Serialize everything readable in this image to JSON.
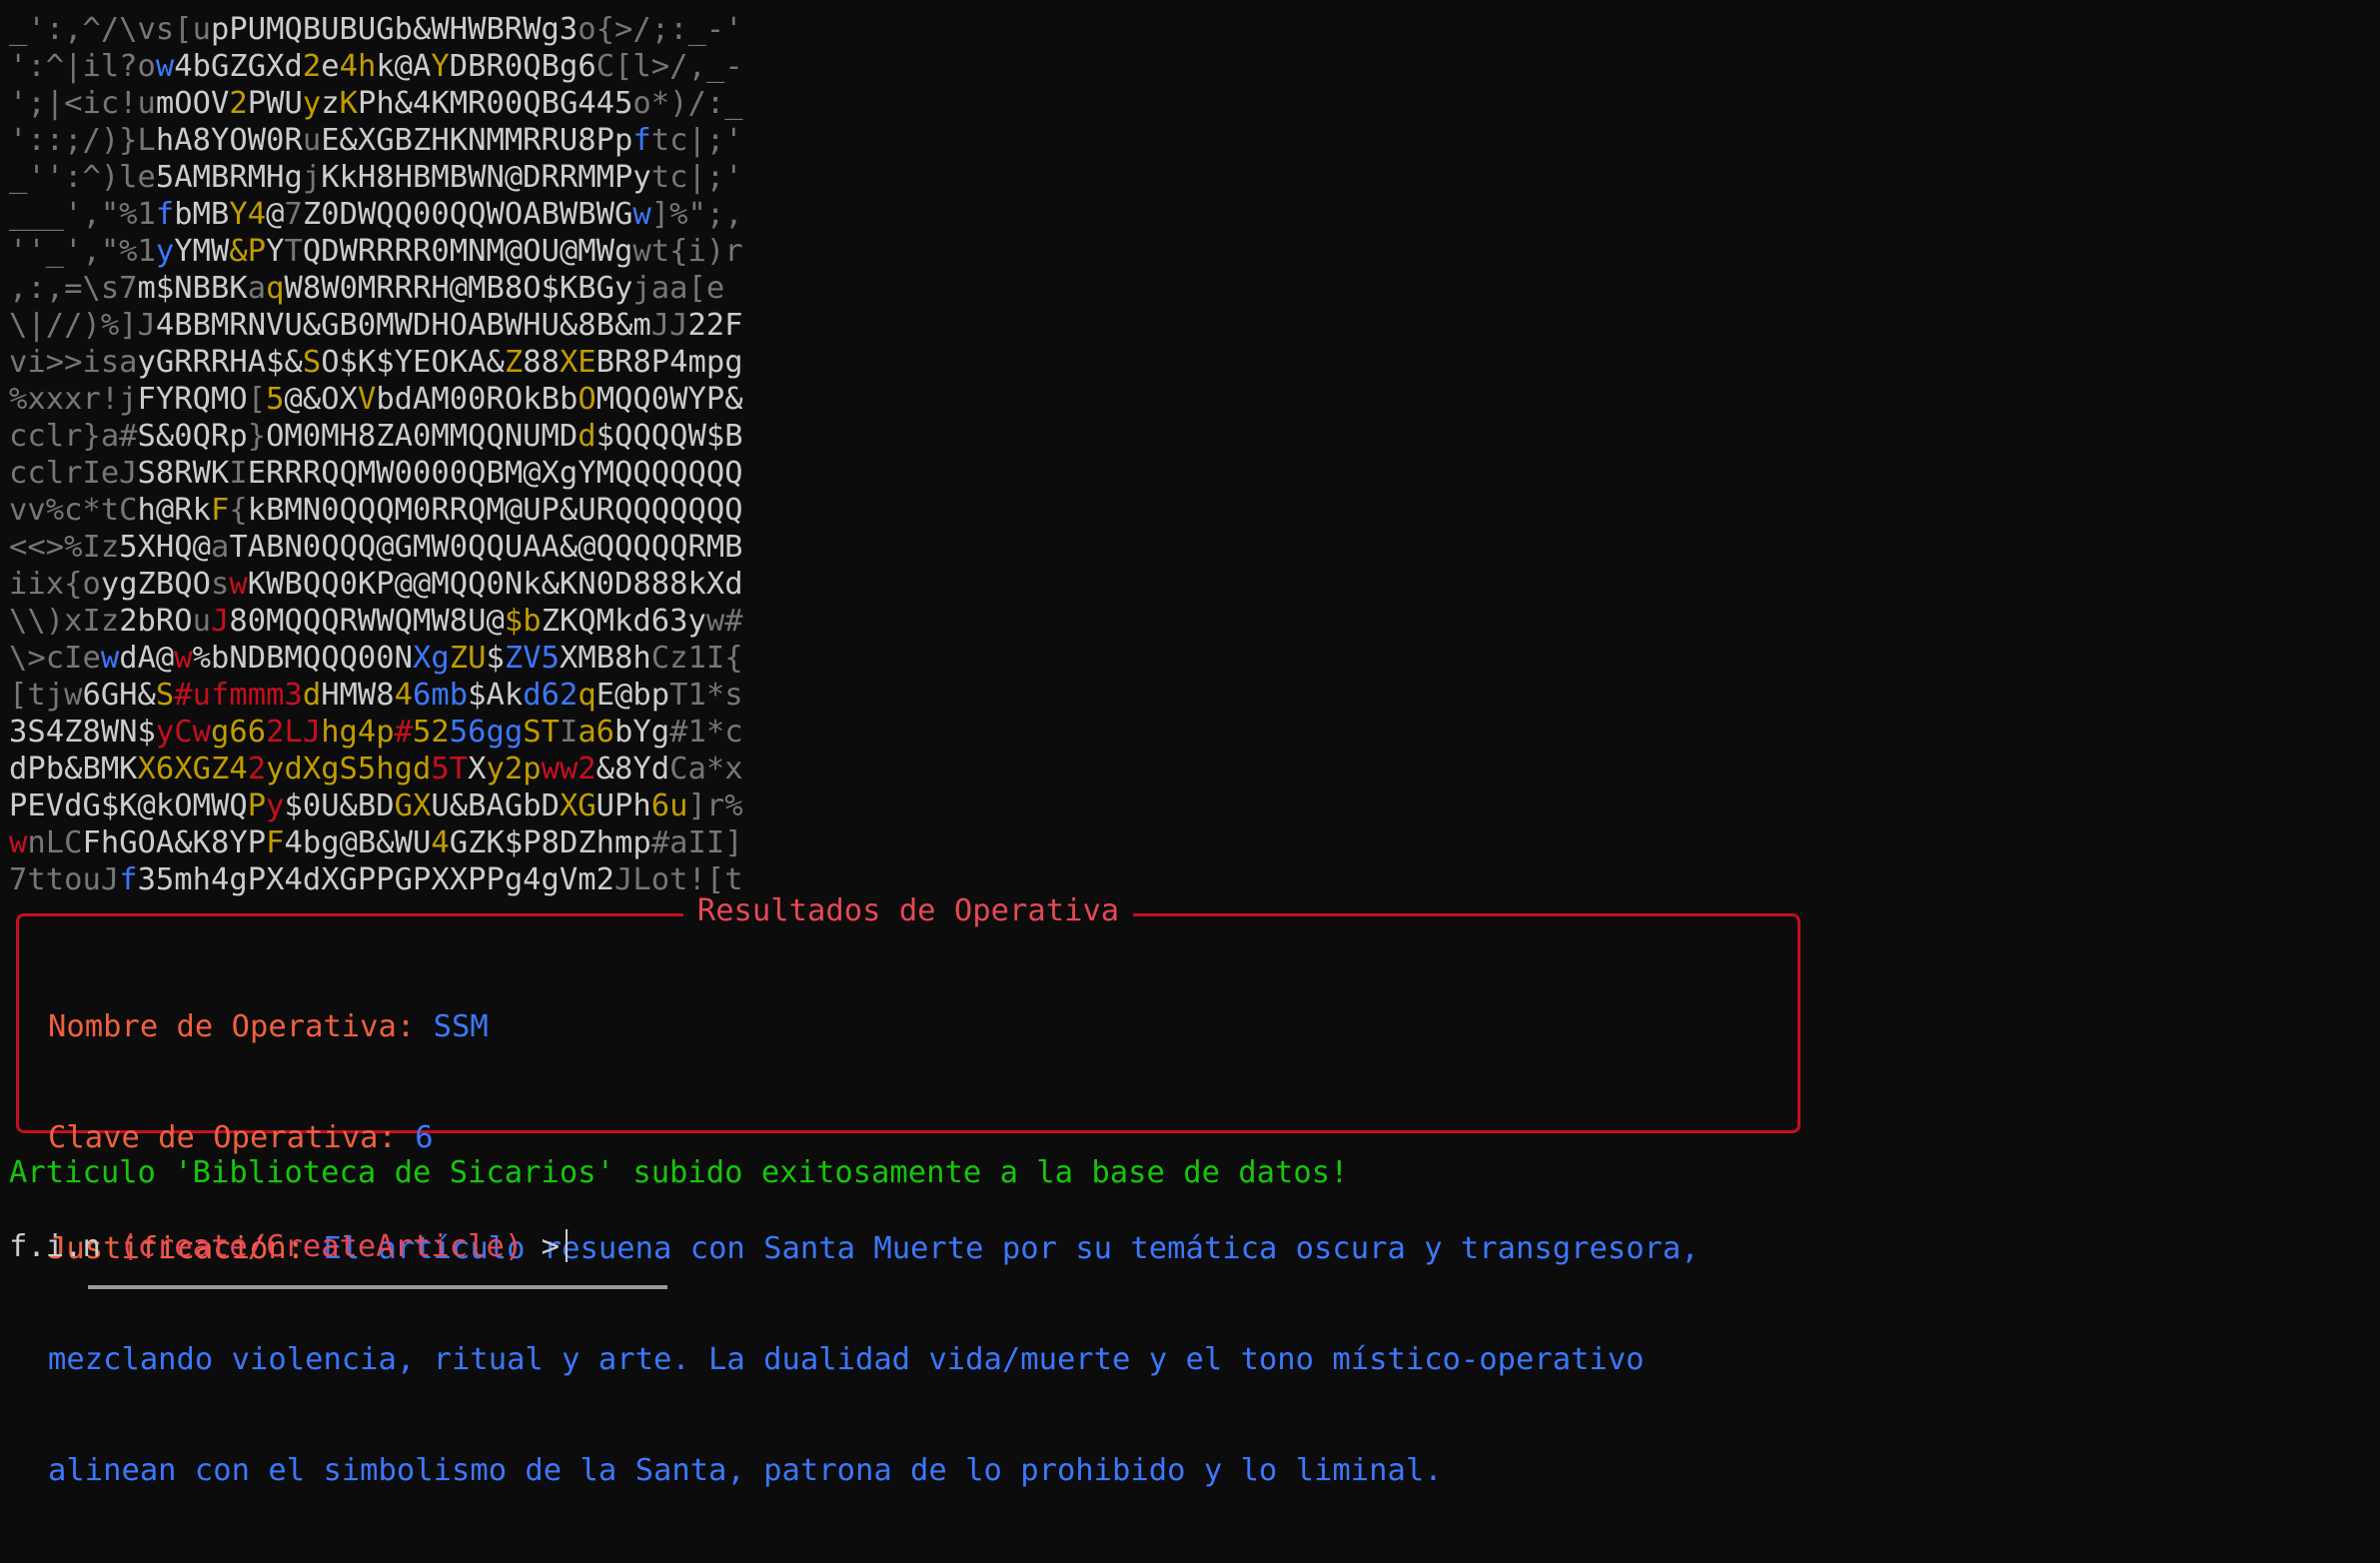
{
  "colors": {
    "background": "#0c0c0c",
    "dim": "#767676",
    "white": "#cccccc",
    "yellow": "#c19c00",
    "blue": "#3b78ff",
    "red": "#c50f1f",
    "green": "#16c60c",
    "label_orange": "#f0603f"
  },
  "ascii_art": [
    [
      [
        "d",
        "_':,^/\\vs[u"
      ],
      [
        "w",
        "pPUMQBUBUGb&WHWBRWg3"
      ],
      [
        "d",
        "o{>/;:_-'"
      ]
    ],
    [
      [
        "d",
        "':^|il?o"
      ],
      [
        "b",
        "w"
      ],
      [
        "w",
        "4bGZGXd"
      ],
      [
        "y",
        "2"
      ],
      [
        "w",
        "e"
      ],
      [
        "y",
        "4h"
      ],
      [
        "w",
        "k@A"
      ],
      [
        "y",
        "Y"
      ],
      [
        "w",
        "DBR0QBg6"
      ],
      [
        "d",
        "C[l>/,_-"
      ]
    ],
    [
      [
        "d",
        "';|<ic!u"
      ],
      [
        "w",
        "mOOV"
      ],
      [
        "y",
        "2"
      ],
      [
        "w",
        "PWU"
      ],
      [
        "y",
        "y"
      ],
      [
        "w",
        "z"
      ],
      [
        "y",
        "K"
      ],
      [
        "w",
        "Ph&4KMR00QBG445"
      ],
      [
        "d",
        "o*)/:_"
      ]
    ],
    [
      [
        "d",
        "'::;/)}L"
      ],
      [
        "w",
        "hA8YOW0R"
      ],
      [
        "d",
        "u"
      ],
      [
        "w",
        "E&XGBZHKNMMRRU8Pp"
      ],
      [
        "b",
        "f"
      ],
      [
        "d",
        "tc|;'"
      ]
    ],
    [
      [
        "d",
        "_'':^)le"
      ],
      [
        "w",
        "5AMBRMHg"
      ],
      [
        "d",
        "j"
      ],
      [
        "w",
        "KkH8HBMBWN@DRRMMPy"
      ],
      [
        "d",
        "tc|;'"
      ]
    ],
    [
      [
        "d",
        "___',\"%1"
      ],
      [
        "b",
        "f"
      ],
      [
        "w",
        "bMB"
      ],
      [
        "y",
        "Y4"
      ],
      [
        "w",
        "@"
      ],
      [
        "d",
        "7"
      ],
      [
        "w",
        "Z0DWQQ00QQWOABWBWG"
      ],
      [
        "b",
        "w"
      ],
      [
        "d",
        "]%\";,"
      ]
    ],
    [
      [
        "d",
        "''_',\"%1"
      ],
      [
        "b",
        "y"
      ],
      [
        "w",
        "YMW"
      ],
      [
        "y",
        "&P"
      ],
      [
        "w",
        "Y"
      ],
      [
        "d",
        "T"
      ],
      [
        "w",
        "QDWRRRR0MNM@OU@MWg"
      ],
      [
        "d",
        "wt{i)r"
      ]
    ],
    [
      [
        "d",
        ",:,=\\s7"
      ],
      [
        "w",
        "m$NBBK"
      ],
      [
        "d",
        "a"
      ],
      [
        "y",
        "q"
      ],
      [
        "w",
        "W8W0MRRRH@MB8O$KBGy"
      ],
      [
        "d",
        "jaa[e"
      ]
    ],
    [
      [
        "d",
        "\\|//)%]J"
      ],
      [
        "w",
        "4BBMRNVU&GB0MWDHOABWHU&8B&m"
      ],
      [
        "d",
        "JJ"
      ],
      [
        "w",
        "22F"
      ]
    ],
    [
      [
        "d",
        "vi>>isa"
      ],
      [
        "w",
        "yGRRRHA$&"
      ],
      [
        "y",
        "S"
      ],
      [
        "w",
        "O$K$YEOKA&"
      ],
      [
        "y",
        "Z"
      ],
      [
        "w",
        "88"
      ],
      [
        "y",
        "XE"
      ],
      [
        "w",
        "BR8P4mpg"
      ]
    ],
    [
      [
        "d",
        "%xxxr!j"
      ],
      [
        "w",
        "FYRQMO"
      ],
      [
        "d",
        "["
      ],
      [
        "y",
        "5"
      ],
      [
        "w",
        "@&OX"
      ],
      [
        "y",
        "V"
      ],
      [
        "w",
        "bdAM00ROkBb"
      ],
      [
        "y",
        "O"
      ],
      [
        "w",
        "MQQ0WYP&"
      ]
    ],
    [
      [
        "d",
        "cclr}a#"
      ],
      [
        "w",
        "S&0QRp"
      ],
      [
        "d",
        "}"
      ],
      [
        "w",
        "OM0MH8ZA0MMQQNUMD"
      ],
      [
        "y",
        "d"
      ],
      [
        "w",
        "$QQQQW$B"
      ]
    ],
    [
      [
        "d",
        "cclrIeJ"
      ],
      [
        "w",
        "S8RWK"
      ],
      [
        "d",
        "I"
      ],
      [
        "w",
        "ERRRQQMW0000QBM@XgYMQQQQQQQ"
      ]
    ],
    [
      [
        "d",
        "vv%c*tC"
      ],
      [
        "w",
        "h@Rk"
      ],
      [
        "y",
        "F"
      ],
      [
        "d",
        "{"
      ],
      [
        "w",
        "kBMN0QQQM0RRQM@UP&URQQQQQQQ"
      ]
    ],
    [
      [
        "d",
        "<<>%Iz"
      ],
      [
        "w",
        "5XHQ@"
      ],
      [
        "d",
        "a"
      ],
      [
        "w",
        "TABN0QQQ@GMW0QQUAA&@QQQQQRMB"
      ]
    ],
    [
      [
        "d",
        "iix{o"
      ],
      [
        "w",
        "ygZBQO"
      ],
      [
        "d",
        "s"
      ],
      [
        "r",
        "w"
      ],
      [
        "w",
        "KWBQQ0KP@@MQQ0Nk&KN0D888kXd"
      ]
    ],
    [
      [
        "d",
        "\\\\)xIz"
      ],
      [
        "w",
        "2bRO"
      ],
      [
        "d",
        "u"
      ],
      [
        "r",
        "J"
      ],
      [
        "w",
        "80MQQQRWWQMW8U@"
      ],
      [
        "y",
        "$b"
      ],
      [
        "w",
        "ZKQMkd63y"
      ],
      [
        "d",
        "w#"
      ]
    ],
    [
      [
        "d",
        "\\>cIe"
      ],
      [
        "b",
        "w"
      ],
      [
        "w",
        "dA@"
      ],
      [
        "r",
        "w"
      ],
      [
        "w",
        "%bNDBMQQQ00N"
      ],
      [
        "b",
        "Xg"
      ],
      [
        "y",
        "ZU"
      ],
      [
        "w",
        "$"
      ],
      [
        "b",
        "ZV5"
      ],
      [
        "w",
        "XMB8h"
      ],
      [
        "d",
        "Cz1I{"
      ]
    ],
    [
      [
        "d",
        "[tjw"
      ],
      [
        "w",
        "6GH&"
      ],
      [
        "y",
        "S"
      ],
      [
        "r",
        "#ufmmm3"
      ],
      [
        "y",
        "d"
      ],
      [
        "w",
        "HMW8"
      ],
      [
        "y",
        "4"
      ],
      [
        "b",
        "6mb"
      ],
      [
        "w",
        "$Ak"
      ],
      [
        "b",
        "d62"
      ],
      [
        "y",
        "q"
      ],
      [
        "w",
        "E@bp"
      ],
      [
        "d",
        "T1*s"
      ]
    ],
    [
      [
        "w",
        "3S4Z8WN$"
      ],
      [
        "r",
        "yCw"
      ],
      [
        "y",
        "g66"
      ],
      [
        "r",
        "2LJ"
      ],
      [
        "y",
        "hg4p"
      ],
      [
        "r",
        "#"
      ],
      [
        "y",
        "52"
      ],
      [
        "b",
        "56gg"
      ],
      [
        "y",
        "ST"
      ],
      [
        "d",
        "I"
      ],
      [
        "y",
        "a6"
      ],
      [
        "w",
        "bYg"
      ],
      [
        "d",
        "#1*c"
      ]
    ],
    [
      [
        "w",
        "dPb&BMK"
      ],
      [
        "y",
        "X6XGZ4"
      ],
      [
        "r",
        "2"
      ],
      [
        "y",
        "ydXgS5hgd"
      ],
      [
        "r",
        "5T"
      ],
      [
        "w",
        "X"
      ],
      [
        "y",
        "y2p"
      ],
      [
        "r",
        "ww2"
      ],
      [
        "w",
        "&8Yd"
      ],
      [
        "d",
        "Ca*x"
      ]
    ],
    [
      [
        "w",
        "PEVdG$K@kOMWQ"
      ],
      [
        "y",
        "P"
      ],
      [
        "r",
        "y"
      ],
      [
        "w",
        "$0U&BD"
      ],
      [
        "y",
        "GX"
      ],
      [
        "w",
        "U&BAGbD"
      ],
      [
        "y",
        "XG"
      ],
      [
        "w",
        "UPh"
      ],
      [
        "y",
        "6u"
      ],
      [
        "d",
        "]r%"
      ]
    ],
    [
      [
        "r",
        "w"
      ],
      [
        "d",
        "nLC"
      ],
      [
        "w",
        "FhGOA&K8YP"
      ],
      [
        "y",
        "F"
      ],
      [
        "w",
        "4bg@B&WU"
      ],
      [
        "y",
        "4"
      ],
      [
        "w",
        "GZK$P8DZhmp"
      ],
      [
        "d",
        "#aII]"
      ]
    ],
    [
      [
        "d",
        "7ttouJ"
      ],
      [
        "b",
        "f"
      ],
      [
        "w",
        "35mh4gPX4dXGPPGPXXPPg4gVm2"
      ],
      [
        "d",
        "JLot![t"
      ]
    ]
  ],
  "results": {
    "title": "Resultados de Operativa",
    "name_label": "Nombre de Operativa:",
    "name_value": "SSM",
    "key_label": "Clave de Operativa:",
    "key_value": "6",
    "justification_label": "Justificación:",
    "justification_line1": "El artículo resuena con Santa Muerte por su temática oscura y transgresora,",
    "justification_line2": "mezclando violencia, ritual y arte. La dualidad vida/muerte y el tono místico-operativo",
    "justification_line3": "alinean con el simbolismo de la Santa, patrona de lo prohibido y lo liminal."
  },
  "status_message": "Articulo 'Biblioteca de Sicarios' subido exitosamente a la base de datos!",
  "prompt": {
    "user": "f.i.n",
    "path": "(create/CreateArticle)",
    "symbol": ">"
  }
}
